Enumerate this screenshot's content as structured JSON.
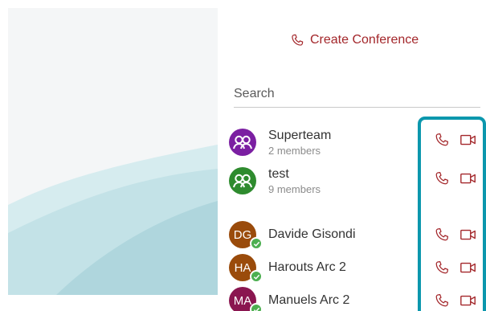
{
  "sidebar": {
    "create_conference_label": "Create Conference",
    "search_placeholder": "Search",
    "groups": [
      {
        "name": "Superteam",
        "members": "2 members",
        "color": "#7b1fa2"
      },
      {
        "name": "test",
        "members": "9 members",
        "color": "#2e8b2e"
      }
    ],
    "contacts": [
      {
        "initials": "DG",
        "name": "Davide Gisondi",
        "color": "#9a4b0b",
        "status": "online"
      },
      {
        "initials": "HA",
        "name": "Harouts Arc 2",
        "color": "#9a4b0b",
        "status": "online"
      },
      {
        "initials": "MA",
        "name": "Manuels Arc 2",
        "color": "#8a1650",
        "status": "online"
      }
    ]
  },
  "colors": {
    "accent": "#a3262a",
    "highlight": "#0b97ad",
    "online": "#4caf50"
  },
  "icons": [
    "phone-icon",
    "video-camera-icon",
    "group-icon",
    "check-icon"
  ]
}
